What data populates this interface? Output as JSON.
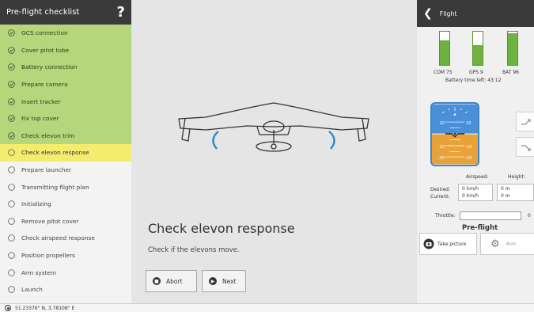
{
  "left": {
    "title": "Pre-flight checklist",
    "help": "?",
    "items": [
      {
        "label": "GCS connection",
        "state": "done"
      },
      {
        "label": "Cover pitot tube",
        "state": "done"
      },
      {
        "label": "Battery connection",
        "state": "done"
      },
      {
        "label": "Prepare camera",
        "state": "done"
      },
      {
        "label": "Insert tracker",
        "state": "done"
      },
      {
        "label": "Fix top cover",
        "state": "done"
      },
      {
        "label": "Check elevon trim",
        "state": "done"
      },
      {
        "label": "Check elevon response",
        "state": "current"
      },
      {
        "label": "Prepare launcher",
        "state": "todo"
      },
      {
        "label": "Transmitting flight plan",
        "state": "todo"
      },
      {
        "label": "Initializing",
        "state": "todo"
      },
      {
        "label": "Remove pitot cover",
        "state": "todo"
      },
      {
        "label": "Check airspeed response",
        "state": "todo"
      },
      {
        "label": "Position propellers",
        "state": "todo"
      },
      {
        "label": "Arm system",
        "state": "todo"
      },
      {
        "label": "Launch",
        "state": "todo"
      }
    ]
  },
  "center": {
    "step_title": "Check elevon response",
    "step_desc": "Check if the elevons move.",
    "abort_label": "Abort",
    "next_label": "Next"
  },
  "right": {
    "title": "Flight",
    "gauges": [
      {
        "label": "COM 75",
        "level": 0.75
      },
      {
        "label": "GPS 9",
        "level": 0.6
      },
      {
        "label": "BAT 96",
        "level": 0.96
      }
    ],
    "battery_time": "Battery time left: 43:12",
    "attitude_ticks": [
      "10",
      "10",
      "-10",
      "-10",
      "-20",
      "-20"
    ],
    "airspeed_label": "Airspeed:",
    "height_label": "Height:",
    "desired_label": "Desired:",
    "current_label": "Current:",
    "desired_airspeed": "0 km/h",
    "current_airspeed": "0 km/h",
    "desired_height": "0 m",
    "current_height": "0 m",
    "throttle_label": "Throttle:",
    "throttle_value": "0",
    "mode": "Pre-flight",
    "take_picture_label": "Take picture",
    "arm_label": "Arm"
  },
  "status": {
    "coords": "51.23376° N, 3.78108° E"
  },
  "colors": {
    "done": "#b5d67a",
    "current": "#f4ec6e",
    "sky": "#4a90d9",
    "ground": "#e8a23a",
    "gauge": "#6db33f"
  },
  "icons": {
    "done": "check-circle-icon",
    "todo": "empty-circle-icon",
    "back": "chevron-left-icon",
    "abort": "stop-icon",
    "next": "play-icon",
    "camera": "camera-icon",
    "arm": "gear-icon",
    "gps": "location-icon"
  }
}
